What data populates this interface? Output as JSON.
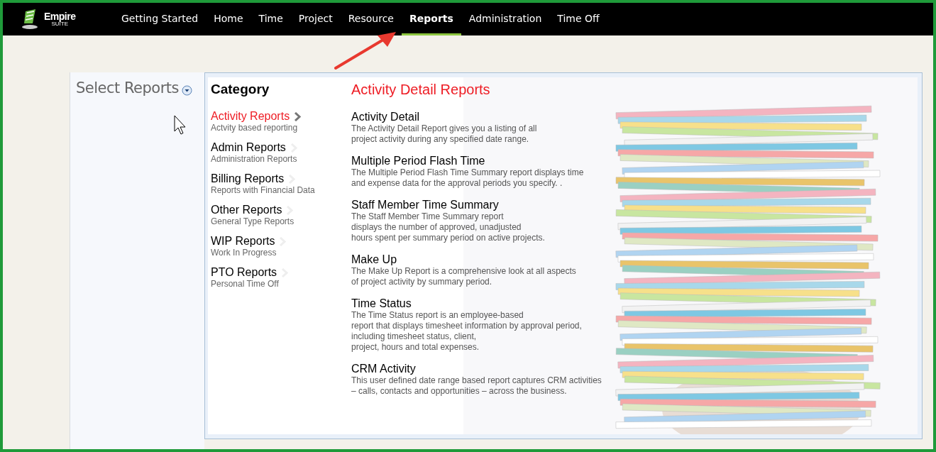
{
  "logo": {
    "name": "Empire",
    "tagline": "SUITE"
  },
  "nav": [
    {
      "label": "Getting Started",
      "selected": false
    },
    {
      "label": "Home",
      "selected": false
    },
    {
      "label": "Time",
      "selected": false
    },
    {
      "label": "Project",
      "selected": false
    },
    {
      "label": "Resource",
      "selected": false
    },
    {
      "label": "Reports",
      "selected": true
    },
    {
      "label": "Administration",
      "selected": false
    },
    {
      "label": "Time Off",
      "selected": false
    }
  ],
  "sidebar": {
    "title": "Select Reports"
  },
  "category": {
    "heading": "Category",
    "items": [
      {
        "label": "Activity Reports",
        "subtitle": "Actvity based reporting",
        "selected": true
      },
      {
        "label": "Admin Reports",
        "subtitle": "Administration Reports",
        "selected": false
      },
      {
        "label": "Billing Reports",
        "subtitle": "Reports with Financial Data",
        "selected": false
      },
      {
        "label": "Other Reports",
        "subtitle": "General Type Reports",
        "selected": false
      },
      {
        "label": "WIP Reports",
        "subtitle": "Work In Progress",
        "selected": false
      },
      {
        "label": "PTO Reports",
        "subtitle": "Personal Time Off",
        "selected": false
      }
    ]
  },
  "reports": {
    "heading": "Activity Detail Reports",
    "items": [
      {
        "title": "Activity Detail",
        "description": "The Activity Detail Report gives you a listing of all\nproject activity during any specified date range."
      },
      {
        "title": "Multiple Period Flash Time",
        "description": "The Multiple Period Flash Time Summary report displays time\nand expense data for the approval periods you specify. ."
      },
      {
        "title": "Staff Member Time Summary",
        "description": "The Staff Member Time Summary report\ndisplays the number of approved, unadjusted\nhours spent per summary period on active projects."
      },
      {
        "title": "Make Up",
        "description": "The Make Up Report is a comprehensive look at all aspects\nof project activity by summary period."
      },
      {
        "title": "Time Status",
        "description": "The Time Status report is an employee-based\nreport that displays timesheet information by approval period,\nincluding timesheet status, client,\nproject, hours and total expenses."
      },
      {
        "title": "CRM Activity",
        "description": "This user defined date range based report captures CRM activities\n– calls, contacts and opportunities – across the business."
      }
    ]
  }
}
